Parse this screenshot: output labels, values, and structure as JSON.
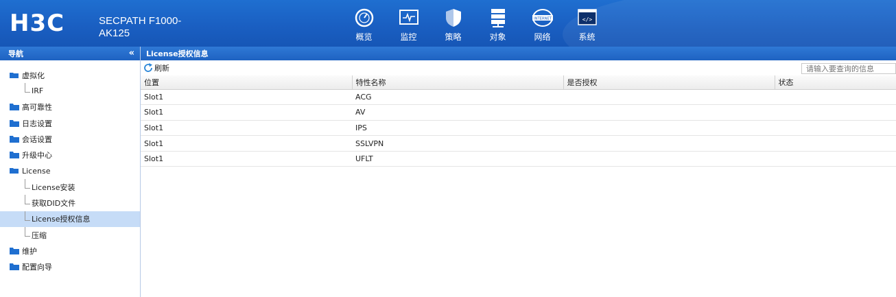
{
  "header": {
    "brand": "H3C",
    "product": "SECPATH F1000-AK125",
    "nav": [
      {
        "label": "概览",
        "icon": "gauge-icon"
      },
      {
        "label": "监控",
        "icon": "monitor-icon"
      },
      {
        "label": "策略",
        "icon": "shield-icon"
      },
      {
        "label": "对象",
        "icon": "server-icon"
      },
      {
        "label": "网络",
        "icon": "internet-icon",
        "icon_text": "INTERNET"
      },
      {
        "label": "系统",
        "icon": "code-icon",
        "icon_text": "</>"
      }
    ]
  },
  "sidebar": {
    "title": "导航",
    "collapse": "«",
    "items": [
      {
        "label": "虚拟化",
        "type": "folder-open"
      },
      {
        "label": "IRF",
        "type": "leaf"
      },
      {
        "label": "高可靠性",
        "type": "folder"
      },
      {
        "label": "日志设置",
        "type": "folder"
      },
      {
        "label": "会话设置",
        "type": "folder"
      },
      {
        "label": "升级中心",
        "type": "folder"
      },
      {
        "label": "License",
        "type": "folder-open"
      },
      {
        "label": "License安装",
        "type": "leaf"
      },
      {
        "label": "获取DID文件",
        "type": "leaf"
      },
      {
        "label": "License授权信息",
        "type": "leaf",
        "selected": true
      },
      {
        "label": "压缩",
        "type": "leaf"
      },
      {
        "label": "维护",
        "type": "folder"
      },
      {
        "label": "配置向导",
        "type": "folder"
      }
    ]
  },
  "main": {
    "title": "License授权信息",
    "refresh": "刷新",
    "search_placeholder": "请输入要查询的信息",
    "columns": [
      "位置",
      "特性名称",
      "是否授权",
      "状态"
    ],
    "rows": [
      [
        "Slot1",
        "ACG",
        "",
        ""
      ],
      [
        "Slot1",
        "AV",
        "",
        ""
      ],
      [
        "Slot1",
        "IPS",
        "",
        ""
      ],
      [
        "Slot1",
        "SSLVPN",
        "",
        ""
      ],
      [
        "Slot1",
        "UFLT",
        "",
        ""
      ]
    ]
  },
  "colors": {
    "header_blue": "#1a5fc2",
    "panel_head": "#2f79d6",
    "folder": "#1f6fd0",
    "selected_row": "#c6dcf7"
  }
}
